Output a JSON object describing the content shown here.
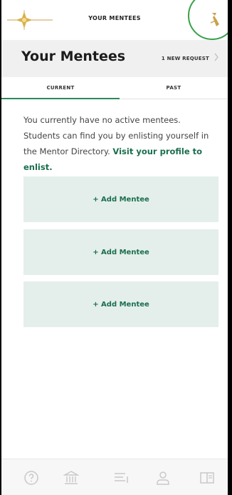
{
  "topbar": {
    "title": "YOUR MENTEES"
  },
  "header": {
    "title": "Your Mentees",
    "request_label": "1 NEW REQUEST"
  },
  "tabs": [
    {
      "label": "CURRENT",
      "active": true
    },
    {
      "label": "PAST",
      "active": false
    }
  ],
  "message": {
    "text": "You currently have no active mentees. Students can find you by enlisting yourself in the Mentor Directory. ",
    "link": "Visit your profile to enlist."
  },
  "cards": [
    {
      "label": "+ Add Mentee"
    },
    {
      "label": "+ Add Mentee"
    },
    {
      "label": "+ Add Mentee"
    }
  ],
  "colors": {
    "accent": "#1b6e4f",
    "highlight": "#3aa04a",
    "card": "#e4efeb",
    "gold": "#c9a24a"
  },
  "bottom_nav": [
    {
      "icon": "help-circle-icon"
    },
    {
      "icon": "institution-icon"
    },
    {
      "icon": "list-icon"
    },
    {
      "icon": "person-icon"
    },
    {
      "icon": "book-icon"
    }
  ]
}
